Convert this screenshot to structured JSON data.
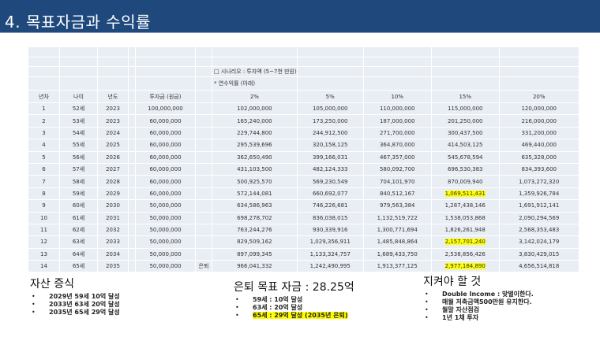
{
  "title": "4. 목표자금과 수익률",
  "table": {
    "scenario": "□ 시나리오 : 투자액 (5~7천 만원)",
    "note": "* 연수익률 (아래)",
    "retire_label": "은퇴",
    "headers": [
      "년차",
      "나이",
      "년도",
      "투자금 (원금)",
      "2%",
      "5%",
      "10%",
      "15%",
      "20%"
    ],
    "rows": [
      [
        "1",
        "52세",
        "2023",
        "100,000,000",
        "102,000,000",
        "105,000,000",
        "110,000,000",
        "115,000,000",
        "120,000,000"
      ],
      [
        "2",
        "53세",
        "2023",
        "60,000,000",
        "165,240,000",
        "173,250,000",
        "187,000,000",
        "201,250,000",
        "216,000,000"
      ],
      [
        "3",
        "54세",
        "2024",
        "60,000,000",
        "229,744,800",
        "244,912,500",
        "271,700,000",
        "300,437,500",
        "331,200,000"
      ],
      [
        "4",
        "55세",
        "2025",
        "60,000,000",
        "295,539,696",
        "320,158,125",
        "364,870,000",
        "414,503,125",
        "469,440,000"
      ],
      [
        "5",
        "56세",
        "2026",
        "60,000,000",
        "362,650,490",
        "399,166,031",
        "467,357,000",
        "545,678,594",
        "635,328,000"
      ],
      [
        "6",
        "57세",
        "2027",
        "60,000,000",
        "431,103,500",
        "482,124,333",
        "580,092,700",
        "696,530,383",
        "834,393,600"
      ],
      [
        "7",
        "58세",
        "2028",
        "60,000,000",
        "500,925,570",
        "569,230,549",
        "704,101,970",
        "870,009,940",
        "1,073,272,320"
      ],
      [
        "8",
        "59세",
        "2029",
        "60,000,000",
        "572,144,081",
        "660,692,077",
        "840,512,167",
        "1,069,511,431",
        "1,359,926,784"
      ],
      [
        "9",
        "60세",
        "2030",
        "50,000,000",
        "634,586,963",
        "746,226,681",
        "979,563,384",
        "1,287,438,146",
        "1,691,912,141"
      ],
      [
        "10",
        "61세",
        "2031",
        "50,000,000",
        "698,278,702",
        "836,038,015",
        "1,132,519,722",
        "1,538,053,868",
        "2,090,294,569"
      ],
      [
        "11",
        "62세",
        "2032",
        "50,000,000",
        "763,244,276",
        "930,339,916",
        "1,300,771,694",
        "1,826,261,948",
        "2,568,353,483"
      ],
      [
        "12",
        "63세",
        "2033",
        "50,000,000",
        "829,509,162",
        "1,029,356,911",
        "1,485,848,864",
        "2,157,701,240",
        "3,142,024,179"
      ],
      [
        "13",
        "64세",
        "2034",
        "50,000,000",
        "897,099,345",
        "1,133,324,757",
        "1,689,433,750",
        "2,538,856,426",
        "3,830,429,015"
      ],
      [
        "14",
        "65세",
        "2035",
        "50,000,000",
        "966,041,332",
        "1,242,490,995",
        "1,913,377,125",
        "2,977,184,890",
        "4,656,514,818"
      ]
    ],
    "highlight_rows": [
      7,
      11,
      13
    ],
    "highlight_color": "#ffff00"
  },
  "asset": {
    "title": "자산 증식",
    "items": [
      "2029년 59세 10억 달성",
      "2033년 63세 20억 달성",
      "2035년 65세 29억 달성"
    ]
  },
  "goal": {
    "title": "은퇴 목표 자금 : 28.25억",
    "items": [
      "59세 : 10억 달성",
      "63세 : 20억 달성",
      "65세 : 29억 달성 (2035년 은퇴)"
    ]
  },
  "rules": {
    "title": "지켜야 할 것",
    "items": [
      "Double Income : 맞벌이한다.",
      "매월 저축금액500만원 유지한다.",
      "월말 자산점검",
      "1년 1채 투자"
    ]
  }
}
